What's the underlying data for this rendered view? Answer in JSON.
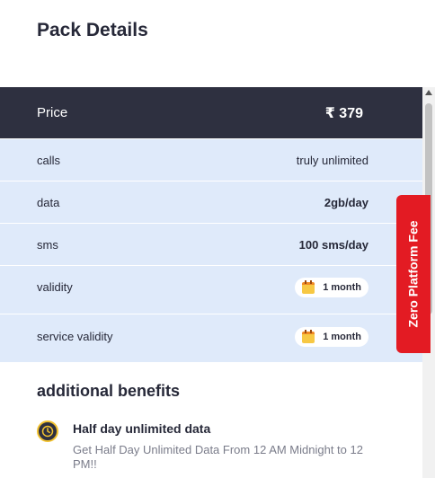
{
  "page": {
    "title": "Pack Details"
  },
  "price": {
    "label": "Price",
    "value": "₹ 379"
  },
  "rows": [
    {
      "label": "calls",
      "value": "truly unlimited"
    },
    {
      "label": "data",
      "value": "2gb/day"
    },
    {
      "label": "sms",
      "value": "100 sms/day"
    },
    {
      "label": "validity",
      "value": "1 month",
      "icon": "calendar-icon"
    },
    {
      "label": "service validity",
      "value": "1 month",
      "icon": "calendar-icon"
    }
  ],
  "side_tab": {
    "label": "Zero Platform Fee",
    "color": "#e31b23"
  },
  "benefits": {
    "title": "additional benefits",
    "items": [
      {
        "icon": "clock-icon",
        "title": "Half day unlimited data",
        "description": "Get Half Day Unlimited Data From 12 AM Midnight to 12 PM!!"
      }
    ]
  },
  "colors": {
    "header_bg": "#2e3040",
    "row_bg": "#dfeafa",
    "accent": "#f2c230"
  }
}
